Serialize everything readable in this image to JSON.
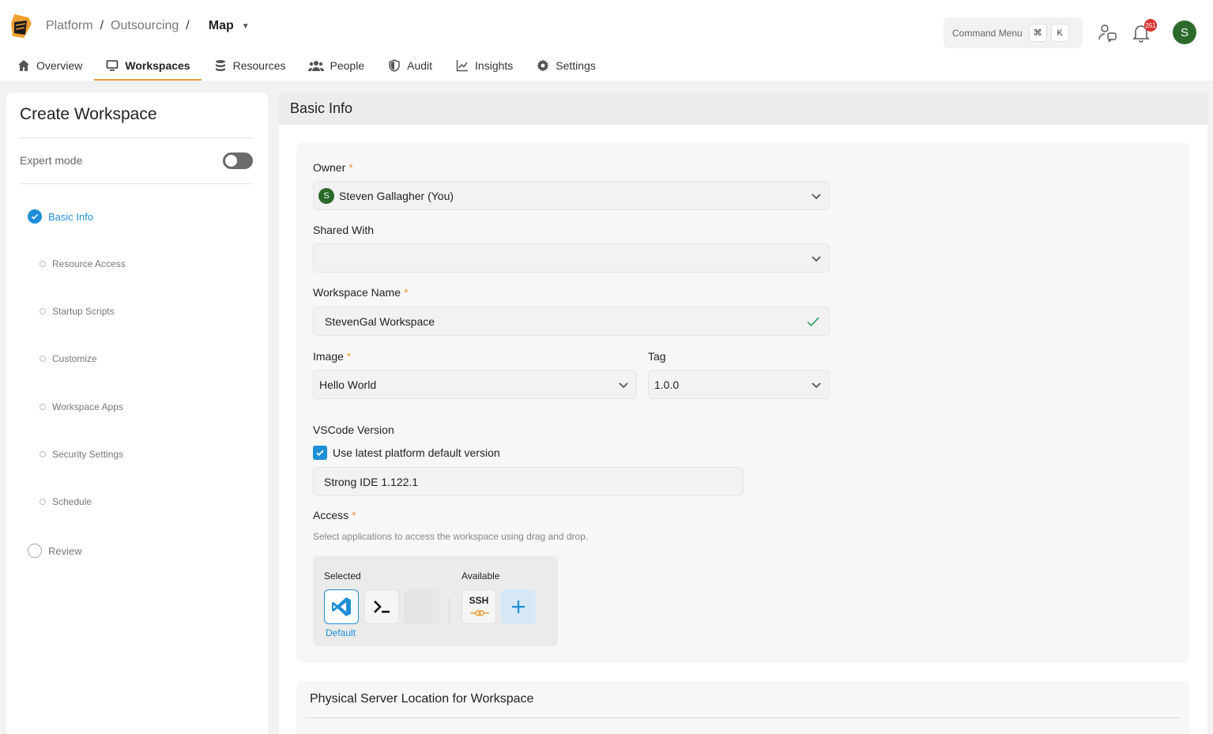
{
  "header": {
    "breadcrumb": [
      "Platform",
      "Outsourcing",
      "Map"
    ],
    "command_menu": {
      "label": "Command Menu",
      "keys": [
        "⌘",
        "K"
      ]
    },
    "notifications_count": "251",
    "user_initial": "S"
  },
  "nav": {
    "tabs": [
      {
        "label": "Overview",
        "icon": "home-icon"
      },
      {
        "label": "Workspaces",
        "icon": "monitor-icon",
        "active": true
      },
      {
        "label": "Resources",
        "icon": "database-icon"
      },
      {
        "label": "People",
        "icon": "people-icon"
      },
      {
        "label": "Audit",
        "icon": "shield-icon"
      },
      {
        "label": "Insights",
        "icon": "chart-line-icon"
      },
      {
        "label": "Settings",
        "icon": "gear-icon"
      }
    ]
  },
  "sidebar": {
    "title": "Create Workspace",
    "expert_mode_label": "Expert mode",
    "expert_mode_on": false,
    "steps": [
      {
        "label": "Basic Info",
        "state": "done"
      },
      {
        "label": "Resource Access",
        "state": "pending"
      },
      {
        "label": "Startup Scripts",
        "state": "pending"
      },
      {
        "label": "Customize",
        "state": "pending"
      },
      {
        "label": "Workspace Apps",
        "state": "pending"
      },
      {
        "label": "Security Settings",
        "state": "pending"
      },
      {
        "label": "Schedule",
        "state": "pending"
      },
      {
        "label": "Review",
        "state": "final"
      }
    ]
  },
  "form": {
    "section_title": "Basic Info",
    "owner": {
      "label": "Owner",
      "value": "Steven Gallagher (You)",
      "avatar_initial": "S"
    },
    "shared_with": {
      "label": "Shared With",
      "value": ""
    },
    "workspace_name": {
      "label": "Workspace Name",
      "value": "StevenGal Workspace"
    },
    "image": {
      "label": "Image",
      "value": "Hello World"
    },
    "tag": {
      "label": "Tag",
      "value": "1.0.0"
    },
    "vscode": {
      "label": "VSCode Version",
      "checkbox_label": "Use latest platform default version",
      "checked": true,
      "value": "Strong IDE 1.122.1"
    },
    "access": {
      "label": "Access",
      "helper": "Select applications to access the workspace using drag and drop.",
      "selected_label": "Selected",
      "available_label": "Available",
      "selected_apps": [
        "vscode-icon",
        "terminal-icon"
      ],
      "default_label": "Default",
      "available_apps": [
        "SSH"
      ]
    },
    "next_section_title": "Physical Server Location for Workspace"
  },
  "colors": {
    "accent": "#1e8fd6",
    "tab_underline": "#e89a3c",
    "avatar": "#2b6a2b",
    "required": "#e89a3c",
    "badge": "#d93636"
  }
}
